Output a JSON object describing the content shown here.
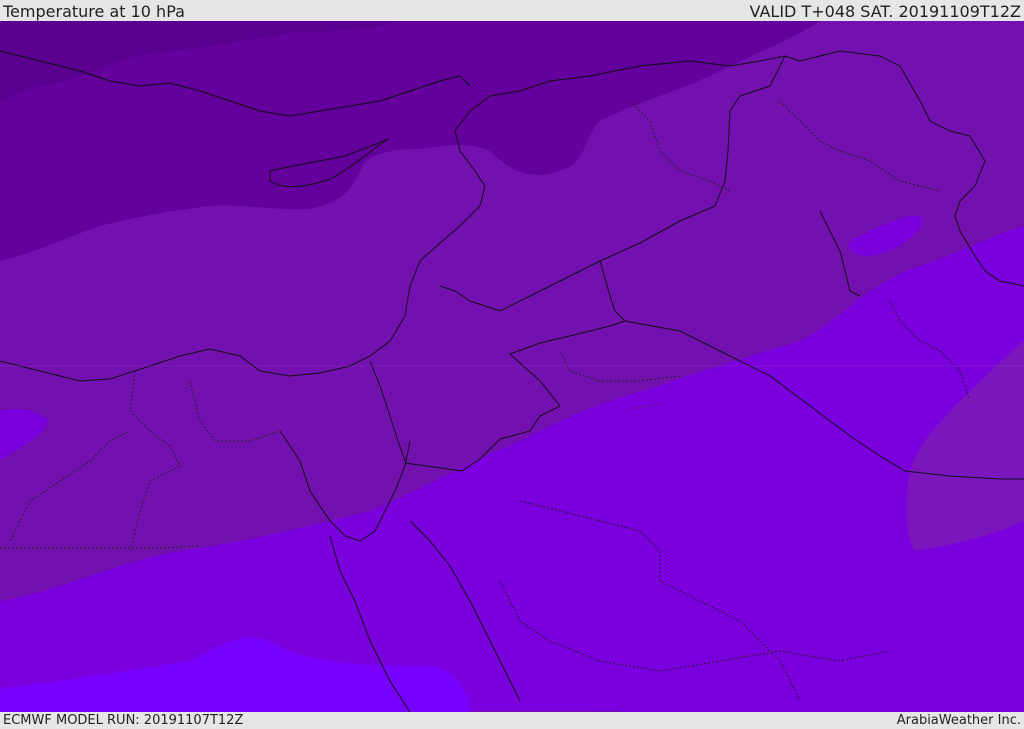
{
  "header": {
    "title": "Temperature at 10 hPa",
    "valid": "VALID T+048 SAT. 20191109T12Z"
  },
  "footer": {
    "model_run": "ECMWF MODEL RUN: 20191107T12Z",
    "credit": "ArabiaWeather Inc."
  },
  "map": {
    "colors": {
      "band_darkest": "#5a0090",
      "band_dark": "#64009c",
      "band_mid": "#7310b0",
      "band_mid2": "#7b16bd",
      "band_light": "#7a00dd",
      "band_lightest": "#7800ff",
      "border": "#111111"
    }
  }
}
